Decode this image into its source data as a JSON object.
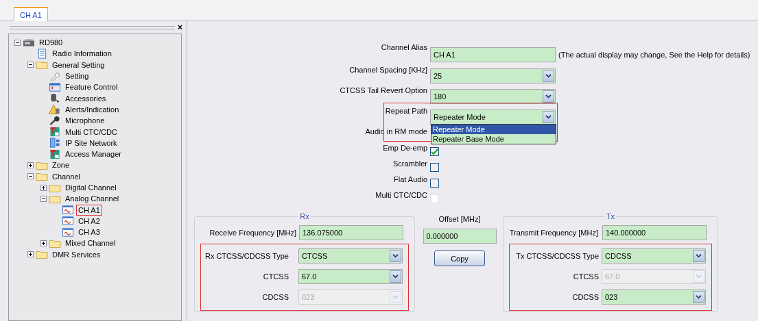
{
  "tabs": [
    {
      "label": "CH A1",
      "selected": true
    }
  ],
  "tree": {
    "close_label": "×",
    "items": [
      {
        "label": "RD980",
        "kind": "radio",
        "expanded": true,
        "children": [
          {
            "label": "Radio Information",
            "kind": "document"
          },
          {
            "label": "General Setting",
            "kind": "folder",
            "expanded": true,
            "children": [
              {
                "label": "Setting",
                "kind": "wrench"
              },
              {
                "label": "Feature Control",
                "kind": "window"
              },
              {
                "label": "Accessories",
                "kind": "accessory"
              },
              {
                "label": "Alerts/Indication",
                "kind": "warning"
              },
              {
                "label": "Microphone",
                "kind": "microphone"
              },
              {
                "label": "Multi CTC/CDC",
                "kind": "tone"
              },
              {
                "label": "IP Site Network",
                "kind": "network"
              },
              {
                "label": "Access Manager",
                "kind": "tone"
              }
            ]
          },
          {
            "label": "Zone",
            "kind": "folder",
            "expanded": false
          },
          {
            "label": "Channel",
            "kind": "folder",
            "expanded": true,
            "children": [
              {
                "label": "Digital Channel",
                "kind": "folder",
                "expanded": false
              },
              {
                "label": "Analog Channel",
                "kind": "folder",
                "expanded": true,
                "children": [
                  {
                    "label": "CH A1",
                    "kind": "channel",
                    "highlighted": true
                  },
                  {
                    "label": "CH A2",
                    "kind": "channel",
                    "highlighted": false
                  },
                  {
                    "label": "CH A3",
                    "kind": "channel",
                    "highlighted": false
                  }
                ]
              },
              {
                "label": "Mixed Channel",
                "kind": "folder",
                "expanded": false
              }
            ]
          },
          {
            "label": "DMR Services",
            "kind": "folder",
            "expanded": false
          }
        ]
      }
    ]
  },
  "form": [
    {
      "kind": "text",
      "label": "Channel Alias",
      "value": "CH A1",
      "note": "(The actual display may change, See the Help for details)"
    },
    {
      "kind": "select",
      "label": "Channel Spacing [KHz]",
      "value": "25"
    },
    {
      "kind": "select",
      "label": "CTCSS Tail Revert Option",
      "value": "180"
    },
    {
      "kind": "select",
      "label": "Repeat Path",
      "value": "Repeater Mode",
      "highlighted": true,
      "options": [
        {
          "label": "Repeater Mode",
          "selected": true
        },
        {
          "label": "Repeater Base Mode",
          "selected": false
        }
      ]
    },
    {
      "kind": "label",
      "label": "Audio in RM mode"
    },
    {
      "kind": "checkbox",
      "label": "Emp De-emp",
      "checked": true,
      "disabled": false
    },
    {
      "kind": "checkbox",
      "label": "Scrambler",
      "checked": false,
      "disabled": false
    },
    {
      "kind": "checkbox",
      "label": "Flat Audio",
      "checked": false,
      "disabled": false
    },
    {
      "kind": "checkbox",
      "label": "Multi CTC/CDC",
      "checked": false,
      "disabled": true
    }
  ],
  "rx": {
    "title": "Rx",
    "frequency_label": "Receive Frequency [MHz]",
    "frequency": "136.075000",
    "highlighted": true,
    "fields": [
      {
        "label": "Rx CTCSS/CDCSS Type",
        "value": "CTCSS",
        "disabled": false
      },
      {
        "label": "CTCSS",
        "value": "67.0",
        "disabled": false
      },
      {
        "label": "CDCSS",
        "value": "023",
        "disabled": true
      }
    ]
  },
  "offset": {
    "label": "Offset [MHz]",
    "value": "0.000000",
    "button": "Copy"
  },
  "tx": {
    "title": "Tx",
    "frequency_label": "Transmit Frequency [MHz]",
    "frequency": "140.000000",
    "highlighted": true,
    "fields": [
      {
        "label": "Tx CTCSS/CDCSS Type",
        "value": "CDCSS",
        "disabled": false
      },
      {
        "label": "CTCSS",
        "value": "67.0",
        "disabled": true
      },
      {
        "label": "CDCSS",
        "value": "023",
        "disabled": false
      }
    ]
  }
}
